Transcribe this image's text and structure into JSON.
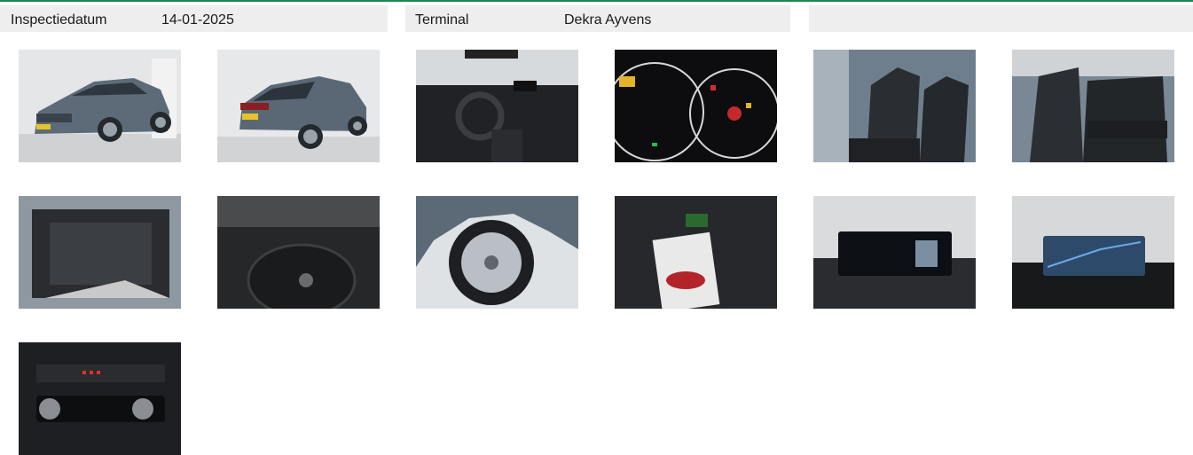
{
  "header": {
    "inspection_date_label": "Inspectiedatum",
    "inspection_date_value": "14-01-2025",
    "terminal_label": "Terminal",
    "terminal_value": "Dekra Ayvens",
    "third_section": ""
  },
  "photos": [
    {
      "name": "front-left-exterior-photo"
    },
    {
      "name": "rear-left-exterior-photo"
    },
    {
      "name": "dashboard-photo"
    },
    {
      "name": "instrument-cluster-photo"
    },
    {
      "name": "front-seats-photo"
    },
    {
      "name": "rear-seats-photo"
    },
    {
      "name": "trunk-photo"
    },
    {
      "name": "spare-wheel-well-photo"
    },
    {
      "name": "wheel-photo"
    },
    {
      "name": "owners-manual-photo"
    },
    {
      "name": "infotainment-screen-photo"
    },
    {
      "name": "navigation-screen-photo"
    },
    {
      "name": "climate-control-photo"
    }
  ]
}
